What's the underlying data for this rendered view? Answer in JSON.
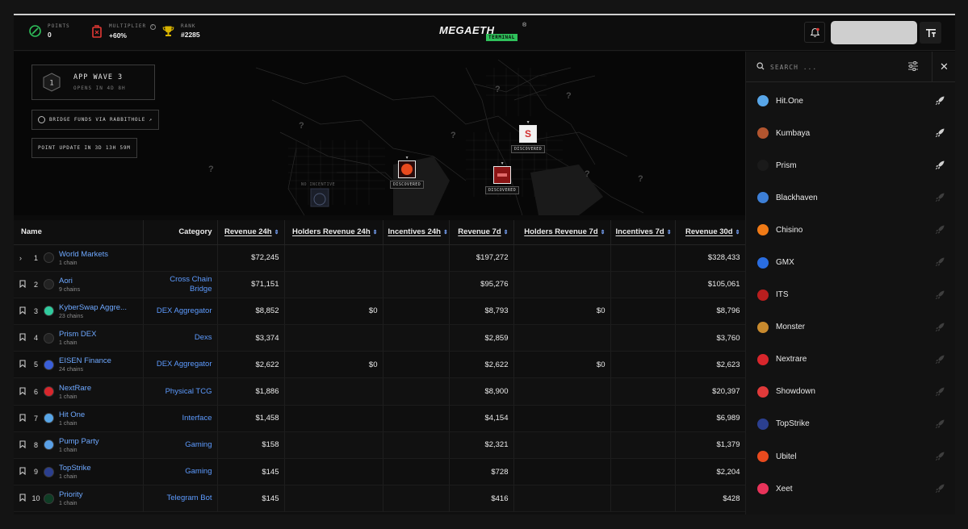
{
  "topbar": {
    "stats": [
      {
        "label": "POINTS",
        "value": "0",
        "icon": "green-circle-icon",
        "color": "#2fc25b"
      },
      {
        "label": "MULTIPLIER",
        "value": "+60%",
        "icon": "fuel-can-icon",
        "color": "#e53935"
      },
      {
        "label": "RANK",
        "value": "#2285",
        "icon": "trophy-icon",
        "color": "#d9b400"
      }
    ],
    "logo_word": "MEGAETH",
    "logo_reg": "®",
    "logo_tag": "TERMINAL"
  },
  "map": {
    "wave_title": "APP WAVE 3",
    "wave_sub": "OPENS IN 4D 8H",
    "wave_badge": "1",
    "bridge_label": "BRIDGE FUNDS VIA RABBITHOLE ↗",
    "point_update": "POINT UPDATE IN 3D 13H 59M",
    "no_incentive": "NO INCENTIVE",
    "discovered_label": "DISCOVERED",
    "question": "?"
  },
  "table": {
    "headers": {
      "name": "Name",
      "category": "Category",
      "rev24": "Revenue 24h",
      "hrev24": "Holders Revenue 24h",
      "inc24": "Incentives 24h",
      "rev7": "Revenue 7d",
      "hrev7": "Holders Revenue 7d",
      "inc7": "Incentives 7d",
      "rev30": "Revenue 30d"
    },
    "sort_glyph": "⇕",
    "rows": [
      {
        "marker": "›",
        "rank": "1",
        "name": "World Markets",
        "chains": "1 chain",
        "category": "",
        "rev24": "$72,245",
        "hrev24": "",
        "inc24": "",
        "rev7": "$197,272",
        "hrev7": "",
        "inc7": "",
        "rev30": "$328,433",
        "color": "#1a1a1a"
      },
      {
        "marker": "🔖",
        "rank": "2",
        "name": "Aori",
        "chains": "9 chains",
        "category": "Cross Chain Bridge",
        "rev24": "$71,151",
        "hrev24": "",
        "inc24": "",
        "rev7": "$95,276",
        "hrev7": "",
        "inc7": "",
        "rev30": "$105,061",
        "color": "#222"
      },
      {
        "marker": "🔖",
        "rank": "3",
        "name": "KyberSwap Aggre...",
        "chains": "23 chains",
        "category": "DEX Aggregator",
        "rev24": "$8,852",
        "hrev24": "$0",
        "inc24": "",
        "rev7": "$8,793",
        "hrev7": "$0",
        "inc7": "",
        "rev30": "$8,796",
        "color": "#31cb9e"
      },
      {
        "marker": "🔖",
        "rank": "4",
        "name": "Prism DEX",
        "chains": "1 chain",
        "category": "Dexs",
        "rev24": "$3,374",
        "hrev24": "",
        "inc24": "",
        "rev7": "$2,859",
        "hrev7": "",
        "inc7": "",
        "rev30": "$3,760",
        "color": "#222"
      },
      {
        "marker": "🔖",
        "rank": "5",
        "name": "EISEN Finance",
        "chains": "24 chains",
        "category": "DEX Aggregator",
        "rev24": "$2,622",
        "hrev24": "$0",
        "inc24": "",
        "rev7": "$2,622",
        "hrev7": "$0",
        "inc7": "",
        "rev30": "$2,623",
        "color": "#3a5fd9"
      },
      {
        "marker": "🔖",
        "rank": "6",
        "name": "NextRare",
        "chains": "1 chain",
        "category": "Physical TCG",
        "rev24": "$1,886",
        "hrev24": "",
        "inc24": "",
        "rev7": "$8,900",
        "hrev7": "",
        "inc7": "",
        "rev30": "$20,397",
        "color": "#d8262c"
      },
      {
        "marker": "🔖",
        "rank": "7",
        "name": "Hit One",
        "chains": "1 chain",
        "category": "Interface",
        "rev24": "$1,458",
        "hrev24": "",
        "inc24": "",
        "rev7": "$4,154",
        "hrev7": "",
        "inc7": "",
        "rev30": "$6,989",
        "color": "#58a6e8"
      },
      {
        "marker": "🔖",
        "rank": "8",
        "name": "Pump Party",
        "chains": "1 chain",
        "category": "Gaming",
        "rev24": "$158",
        "hrev24": "",
        "inc24": "",
        "rev7": "$2,321",
        "hrev7": "",
        "inc7": "",
        "rev30": "$1,379",
        "color": "#5aa0e6"
      },
      {
        "marker": "🔖",
        "rank": "9",
        "name": "TopStrike",
        "chains": "1 chain",
        "category": "Gaming",
        "rev24": "$145",
        "hrev24": "",
        "inc24": "",
        "rev7": "$728",
        "hrev7": "",
        "inc7": "",
        "rev30": "$2,204",
        "color": "#2b3f8f"
      },
      {
        "marker": "🔖",
        "rank": "10",
        "name": "Priority",
        "chains": "1 chain",
        "category": "Telegram Bot",
        "rev24": "$145",
        "hrev24": "",
        "inc24": "",
        "rev7": "$416",
        "hrev7": "",
        "inc7": "",
        "rev30": "$428",
        "color": "#0f3d25"
      }
    ]
  },
  "sidebar": {
    "search_placeholder": "SEARCH ...",
    "close": "✕",
    "items": [
      {
        "label": "Hit.One",
        "color": "#58a6e8",
        "rocket": true
      },
      {
        "label": "Kumbaya",
        "color": "#b2552f",
        "rocket": true
      },
      {
        "label": "Prism",
        "color": "#1a1a1a",
        "rocket": true
      },
      {
        "label": "Blackhaven",
        "color": "#3d7fd6",
        "rocket": false
      },
      {
        "label": "Chisino",
        "color": "#f07a16",
        "rocket": false
      },
      {
        "label": "GMX",
        "color": "#2a6de0",
        "rocket": false
      },
      {
        "label": "ITS",
        "color": "#b81e1e",
        "rocket": false
      },
      {
        "label": "Monster",
        "color": "#c88a2e",
        "rocket": false
      },
      {
        "label": "Nextrare",
        "color": "#d8262c",
        "rocket": false
      },
      {
        "label": "Showdown",
        "color": "#e03a3a",
        "rocket": false
      },
      {
        "label": "TopStrike",
        "color": "#2b3f8f",
        "rocket": false
      },
      {
        "label": "Ubitel",
        "color": "#e84a1e",
        "rocket": false
      },
      {
        "label": "Xeet",
        "color": "#e8335a",
        "rocket": false
      }
    ]
  }
}
